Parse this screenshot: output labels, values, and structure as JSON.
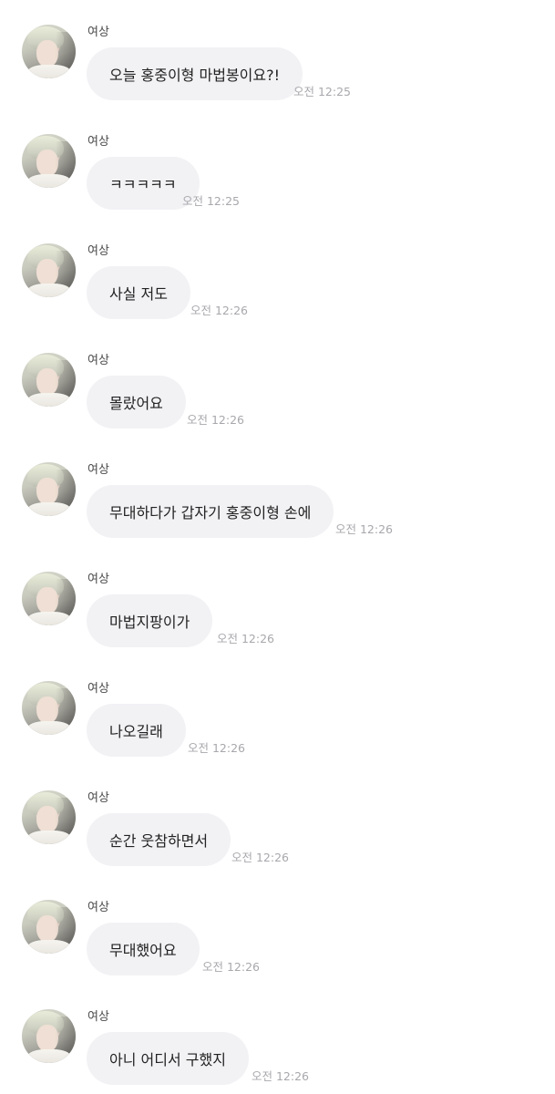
{
  "chat": {
    "messages": [
      {
        "sender": "여상",
        "text": "오늘 홍중이형 마법봉이요?!",
        "time": "오전 12:25",
        "avatar": "profile-photo"
      },
      {
        "sender": "여상",
        "text": "ㅋㅋㅋㅋㅋ",
        "time": "오전 12:25",
        "avatar": "profile-photo"
      },
      {
        "sender": "여상",
        "text": "사실 저도",
        "time": "오전 12:26",
        "avatar": "profile-photo"
      },
      {
        "sender": "여상",
        "text": "몰랐어요",
        "time": "오전 12:26",
        "avatar": "profile-photo"
      },
      {
        "sender": "여상",
        "text": "무대하다가 갑자기 홍중이형 손에",
        "time": "오전 12:26",
        "avatar": "profile-photo"
      },
      {
        "sender": "여상",
        "text": "마법지팡이가",
        "time": "오전 12:26",
        "avatar": "profile-photo"
      },
      {
        "sender": "여상",
        "text": "나오길래",
        "time": "오전 12:26",
        "avatar": "profile-photo"
      },
      {
        "sender": "여상",
        "text": "순간 웃참하면서",
        "time": "오전 12:26",
        "avatar": "profile-photo"
      },
      {
        "sender": "여상",
        "text": "무대했어요",
        "time": "오전 12:26",
        "avatar": "profile-photo"
      },
      {
        "sender": "여상",
        "text": "아니 어디서 구했지",
        "time": "오전 12:26",
        "avatar": "profile-photo"
      }
    ]
  },
  "colors": {
    "bubble": "#f2f2f5",
    "text": "#222222",
    "time": "#a8a8ad",
    "sender": "#4a4a4a"
  }
}
